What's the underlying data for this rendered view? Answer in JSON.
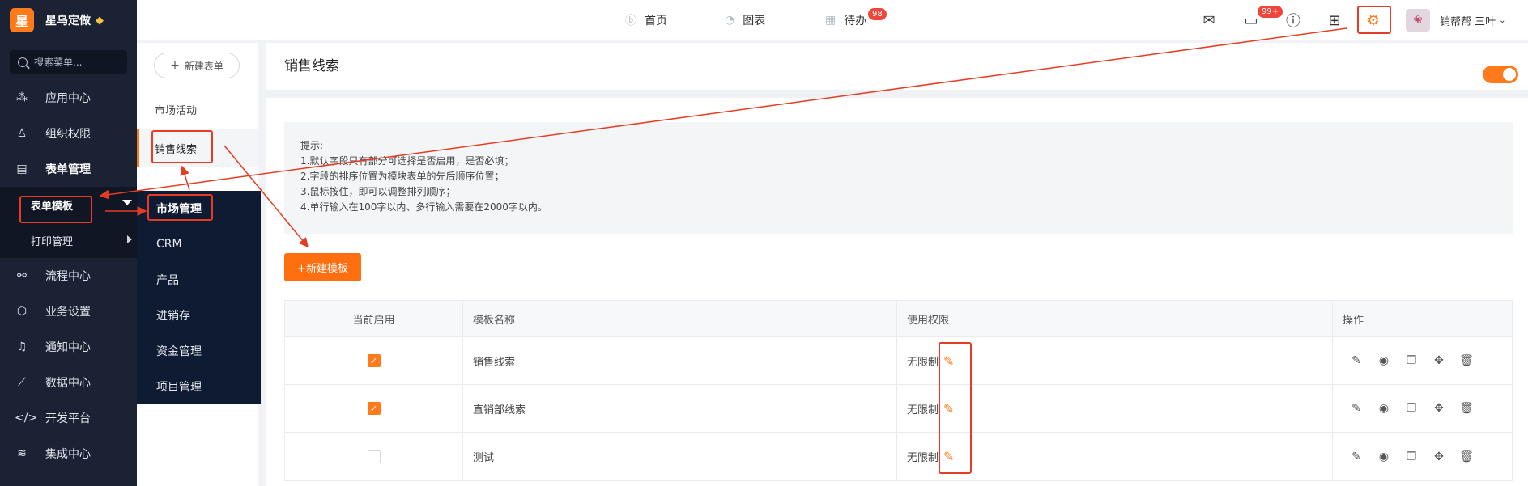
{
  "brand": {
    "logo": "星",
    "name": "星乌定做"
  },
  "search": {
    "placeholder": "搜索菜单..."
  },
  "sidebar": {
    "items": [
      {
        "label": "应用中心",
        "icon": "apps-icon"
      },
      {
        "label": "组织权限",
        "icon": "user-icon"
      },
      {
        "label": "表单管理",
        "icon": "form-icon"
      },
      {
        "label": "流程中心",
        "icon": "flow-icon"
      },
      {
        "label": "业务设置",
        "icon": "cube-icon"
      },
      {
        "label": "通知中心",
        "icon": "bell-icon"
      },
      {
        "label": "数据中心",
        "icon": "chart-icon"
      },
      {
        "label": "开发平台",
        "icon": "code-icon"
      },
      {
        "label": "集成中心",
        "icon": "layers-icon"
      }
    ],
    "sub_items": [
      {
        "label": "表单模板"
      },
      {
        "label": "打印管理"
      }
    ]
  },
  "flyout": {
    "items": [
      "市场管理",
      "CRM",
      "产品",
      "进销存",
      "资金管理",
      "项目管理"
    ]
  },
  "col2": {
    "new_button": "新建表单",
    "items": [
      "市场活动",
      "销售线索"
    ]
  },
  "topbar": {
    "nav": [
      {
        "label": "首页"
      },
      {
        "label": "图表"
      },
      {
        "label": "待办",
        "badge": "98"
      }
    ],
    "message_badge": "99+",
    "user_name": "销帮帮 三叶"
  },
  "main": {
    "title": "销售线索",
    "tips": {
      "heading": "提示:",
      "lines": [
        "1.默认字段只有部分可选择是否启用，是否必填；",
        "2.字段的排序位置为模块表单的先后顺序位置；",
        "3.鼠标按住，即可以调整排列顺序；",
        "4.单行输入在100字以内、多行输入需要在2000字以内。"
      ]
    },
    "new_template": "+新建模板",
    "table": {
      "headers": [
        "当前启用",
        "模板名称",
        "使用权限",
        "操作"
      ],
      "rows": [
        {
          "enabled": true,
          "name": "销售线索",
          "permission": "无限制"
        },
        {
          "enabled": true,
          "name": "直销部线索",
          "permission": "无限制"
        },
        {
          "enabled": false,
          "name": "测试",
          "permission": "无限制"
        }
      ]
    }
  },
  "colors": {
    "accent": "#ff7a1a",
    "sidebar_bg": "#1b2233",
    "annotation_red": "#e53c23"
  }
}
